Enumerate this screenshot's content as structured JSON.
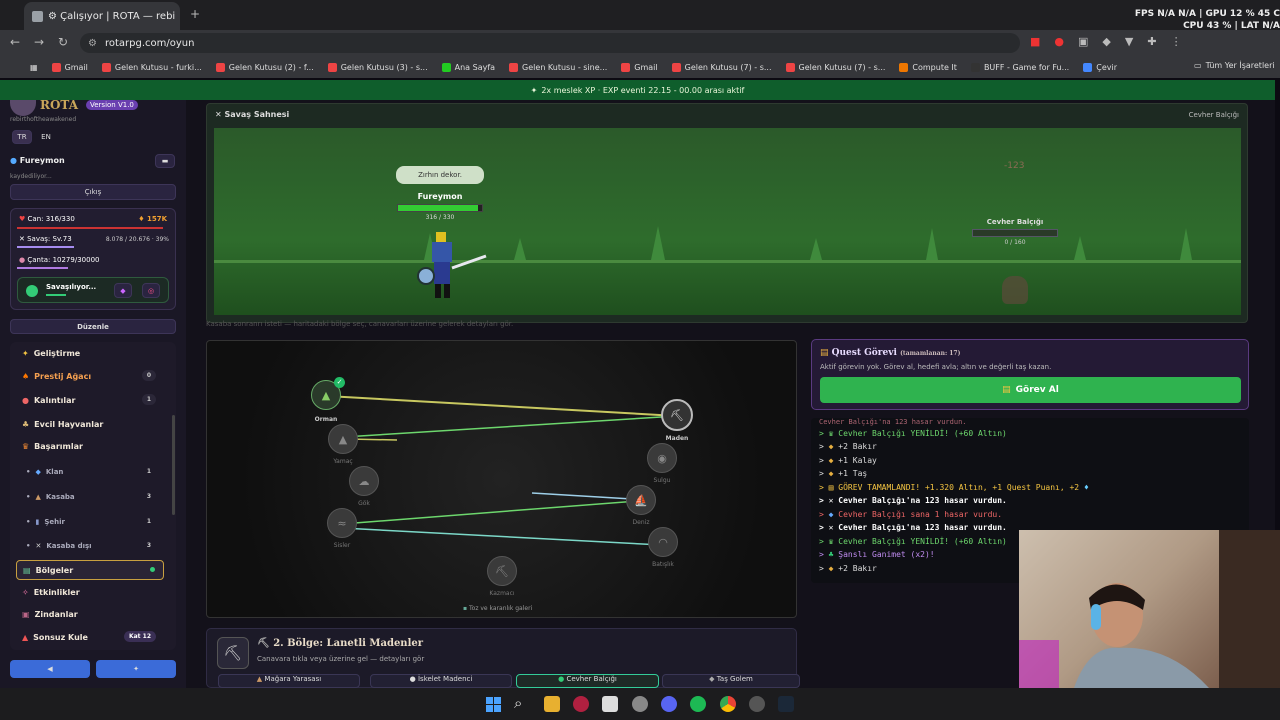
{
  "browser": {
    "tab_title": "⚙ Çalışıyor | ROTA — rebi",
    "url": "rotarpg.com/oyun",
    "bookmarks": [
      "Gmail",
      "Gelen Kutusu - furki...",
      "Gelen Kutusu (2) - f...",
      "Gelen Kutusu (3) - s...",
      "Ana Sayfa",
      "Gelen Kutusu - sine...",
      "Gmail",
      "Gelen Kutusu (7) - s...",
      "Gelen Kutusu (7) - s...",
      "Compute It",
      "BUFF - Game for Fu...",
      "Çevir"
    ],
    "all_bookmarks": "Tüm Yer İşaretleri"
  },
  "overlay": {
    "line1": "FPS N/A N/A | GPU 12 % 45 C",
    "line2": "CPU 43 % | LAT N/A"
  },
  "banner": "2x meslek XP · EXP eventi 22.15 - 00.00 arası aktif",
  "sidebar": {
    "logo": "ROTA",
    "version": "Version V1.0",
    "subtitle": "rebirthoftheawakened",
    "lang_tr": "TR",
    "lang_en": "EN",
    "username": "Fureymon",
    "saving": "kaydediliyor...",
    "logout": "Çıkış",
    "hp": "Can: 316/330",
    "gold": "157K",
    "combat": "Savaş: Sv.73",
    "combat_xp": "8.078 / 20.676 · 39%",
    "bag": "Çanta: 10279/30000",
    "status": "Savaşılıyor...",
    "edit": "Düzenle",
    "menu": [
      {
        "label": "Geliştirme",
        "badge": ""
      },
      {
        "label": "Prestij Ağacı",
        "badge": "0"
      },
      {
        "label": "Kalıntılar",
        "badge": "1"
      },
      {
        "label": "Evcil Hayvanlar",
        "badge": ""
      },
      {
        "label": "Başarımlar",
        "badge": ""
      },
      {
        "label": "Klan",
        "badge": "1"
      },
      {
        "label": "Kasaba",
        "badge": "3"
      },
      {
        "label": "Şehir",
        "badge": "1"
      },
      {
        "label": "Kasaba dışı",
        "badge": "3"
      },
      {
        "label": "Bölgeler",
        "badge": ""
      },
      {
        "label": "Etkinlikler",
        "badge": ""
      },
      {
        "label": "Zindanlar",
        "badge": ""
      },
      {
        "label": "Sonsuz Kule",
        "badge": "Kat 12"
      }
    ]
  },
  "scene": {
    "title": "Savaş Sahnesi",
    "target": "Cevher Balçığı",
    "bubble": "Zırhın dekor.",
    "player": "Fureymon",
    "player_hp": "316 / 330",
    "dmg": "-123",
    "enemy": "Cevher Balçığı",
    "enemy_hp": "0 / 160",
    "hint": "Kasaba sonranrı isteti — haritadaki bölge seç, canavarları üzerine gelerek detayları gör."
  },
  "map": {
    "nodes": [
      "Orman",
      "Yamaç",
      "Gök",
      "Sisler",
      "Kazmacı",
      "Maden",
      "Sulgu",
      "Deniz",
      "Batışlık"
    ],
    "footer": "Toz ve karanlık galeri"
  },
  "quest": {
    "title": "Quest Görevi",
    "subtitle": "(tamamlanan: 17)",
    "desc": "Aktif görevin yok. Görev al, hedefi avla; altın ve değerli taş kazan.",
    "button": "Görev Al"
  },
  "log": [
    "Cevher Balçığı'na 123 hasar vurdun.",
    "Cevher Balçığı YENİLDİ! (+60 Altın)",
    "+2 Bakır",
    "+1 Kalay",
    "+1 Taş",
    "GÖREV TAMAMLANDI! +1.320 Altın, +1 Quest Puanı, +2",
    "Cevher Balçığı'na 123 hasar vurdun.",
    "Cevher Balçığı sana 1 hasar vurdu.",
    "Cevher Balçığı'na 123 hasar vurdun.",
    "Cevher Balçığı YENİLDİ! (+60 Altın)",
    "Şanslı Ganimet (x2)!",
    "+2 Bakır"
  ],
  "region": {
    "title": "2. Bölge: Lanetli Madenler",
    "desc": "Canavara tıkla veya üzerine gel — detayları gör",
    "tabs": [
      "Mağara Yarasası",
      "İskelet Madenci",
      "Cevher Balçığı",
      "Taş Golem"
    ]
  },
  "colors": {
    "accent": "#2fb34f",
    "banner": "#0f5e2c",
    "quest_border": "#5a3a80",
    "gold": "#f0a030"
  }
}
